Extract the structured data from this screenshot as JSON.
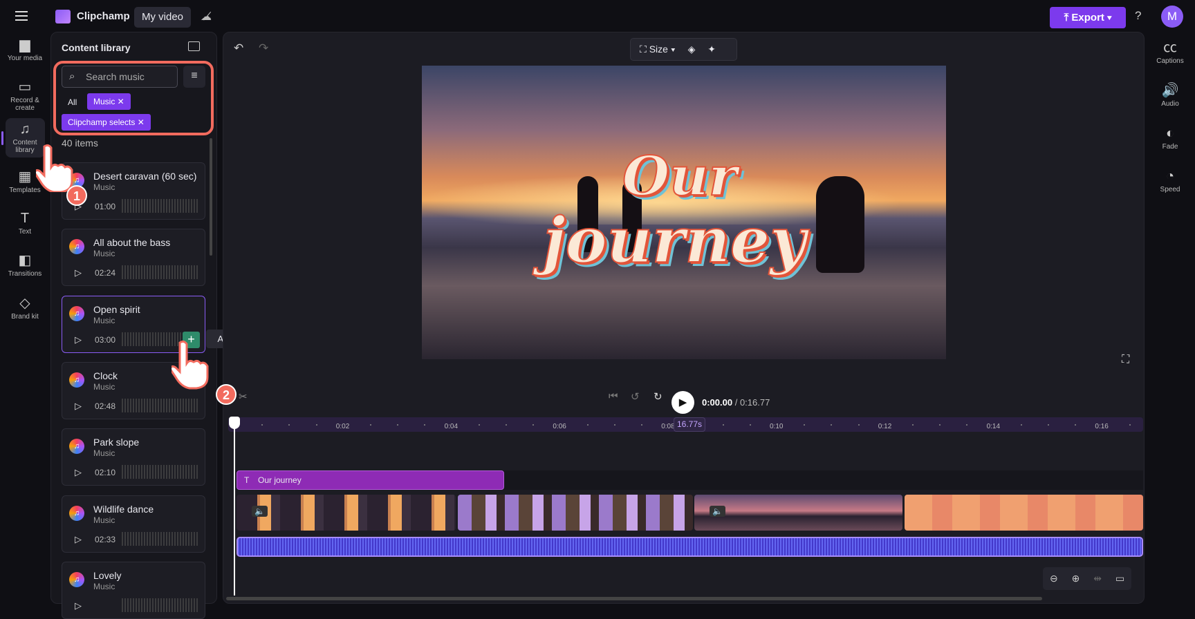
{
  "app": {
    "name": "Clipchamp",
    "project": "My video",
    "export": "Export",
    "help": "?",
    "avatar": "M"
  },
  "left_rail": [
    {
      "label": "Your media",
      "icon": "folder-icon"
    },
    {
      "label": "Record & create",
      "icon": "camera-icon"
    },
    {
      "label": "Content library",
      "icon": "library-icon",
      "active": true
    },
    {
      "label": "Templates",
      "icon": "templates-icon"
    },
    {
      "label": "Text",
      "icon": "text-icon"
    },
    {
      "label": "Transitions",
      "icon": "transitions-icon"
    },
    {
      "label": "Brand kit",
      "icon": "brand-kit-icon"
    }
  ],
  "library": {
    "title": "Content library",
    "search_placeholder": "Search music",
    "filter_all": "All",
    "chips": [
      "Music",
      "Clipchamp selects"
    ],
    "count": "40 items",
    "items": [
      {
        "name": "Desert caravan (60 sec)",
        "type": "Music",
        "duration": "01:00"
      },
      {
        "name": "All about the bass",
        "type": "Music",
        "duration": "02:24"
      },
      {
        "name": "Open spirit",
        "type": "Music",
        "duration": "03:00",
        "selected": true
      },
      {
        "name": "Clock",
        "type": "Music",
        "duration": "02:48"
      },
      {
        "name": "Park slope",
        "type": "Music",
        "duration": "02:10"
      },
      {
        "name": "Wildlife dance",
        "type": "Music",
        "duration": "02:33"
      },
      {
        "name": "Lovely",
        "type": "Music",
        "duration": ""
      }
    ],
    "tooltip": "Add to timeline"
  },
  "steps": [
    "1",
    "2"
  ],
  "preview": {
    "size_label": "Size",
    "title_line1": "Our",
    "title_line2": "journey"
  },
  "playback": {
    "current": "0:00.00",
    "total": "/ 0:16.77"
  },
  "timeline": {
    "ticks": [
      "0:02",
      "0:04",
      "0:06",
      "0:08",
      "0:10",
      "0:12",
      "0:14",
      "0:16"
    ],
    "duration_tag": "16.77s",
    "text_clip": "Our journey"
  },
  "right_rail": [
    {
      "label": "Captions",
      "icon": "captions-icon"
    },
    {
      "label": "Audio",
      "icon": "speaker-icon"
    },
    {
      "label": "Fade",
      "icon": "fade-icon"
    },
    {
      "label": "Speed",
      "icon": "speedometer-icon"
    }
  ],
  "colors": {
    "accent": "#7c3aed",
    "highlight": "#f26b5e",
    "add": "#2e8b6a"
  }
}
